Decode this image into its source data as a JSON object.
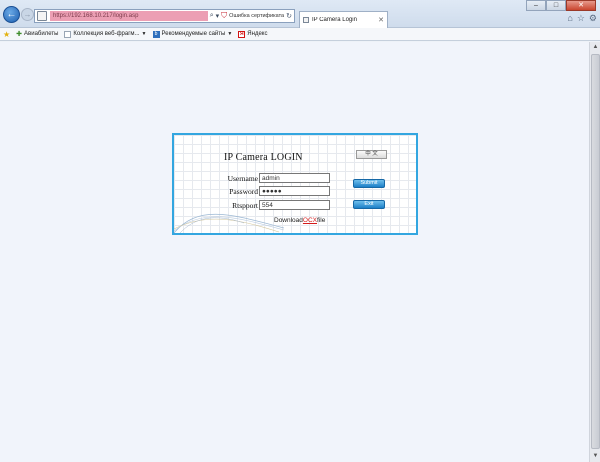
{
  "browser": {
    "address_url": "https://192.168.10.217/login.asp",
    "cert_error_text": "Ошибка сертификата",
    "tab_title": "IP Camera Login",
    "window_controls": [
      "–",
      "□",
      "✕"
    ],
    "toolbar_icons": [
      "home-icon",
      "star-icon",
      "gear-icon"
    ]
  },
  "favorites": {
    "items": [
      {
        "label": "Авиабилеты",
        "icon": "plus-icon"
      },
      {
        "label": "Коллекция веб-фрагм...",
        "icon": "page-icon",
        "dropdown": true
      },
      {
        "label": "Рекомендуемые сайты",
        "icon": "b-icon",
        "dropdown": true
      },
      {
        "label": "Яндекс",
        "icon": "yandex-icon"
      }
    ]
  },
  "login": {
    "title": "IP Camera LOGIN",
    "lang_button": "中 文",
    "username_label": "Username",
    "username_value": "admin",
    "password_label": "Password",
    "password_value": "●●●●●",
    "rtspport_label": "Rtspport",
    "rtspport_value": "554",
    "submit_label": "Submit",
    "exit_label": "Exit",
    "download_prefix": "Download",
    "download_link": "OCX",
    "download_suffix": "file"
  },
  "colors": {
    "panel_border": "#33a6e0",
    "button_blue": "#1c7fc7",
    "link_red": "#d41b1b",
    "cert_error_bg": "#ec9fb4"
  }
}
